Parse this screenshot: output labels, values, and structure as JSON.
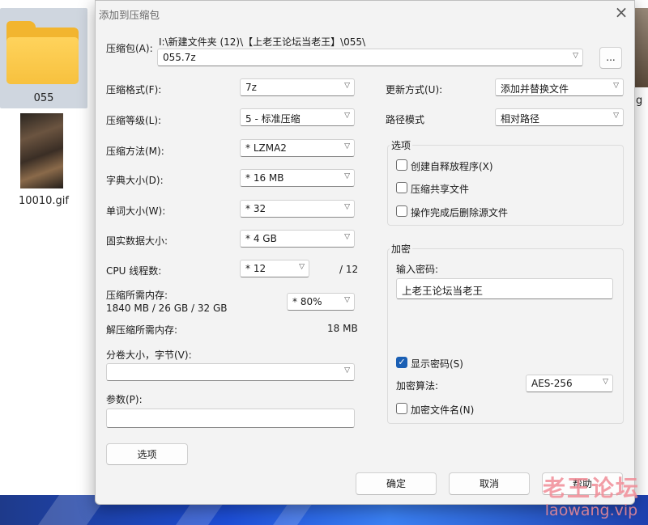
{
  "desktop": {
    "files": [
      {
        "name": "055"
      },
      {
        "name": "10010.gif"
      }
    ],
    "edge_label": "g"
  },
  "dialog": {
    "title": "添加到压缩包",
    "close_icon": "×",
    "archive": {
      "label": "压缩包(A):",
      "path": "I:\\新建文件夹 (12)\\【上老王论坛当老王】\\055\\",
      "name": "055.7z",
      "browse_label": "..."
    },
    "left": {
      "format": {
        "label": "压缩格式(F):",
        "value": "7z"
      },
      "level": {
        "label": "压缩等级(L):",
        "value": "5 - 标准压缩"
      },
      "method": {
        "label": "压缩方法(M):",
        "value": "* LZMA2"
      },
      "dict": {
        "label": "字典大小(D):",
        "value": "* 16 MB"
      },
      "word": {
        "label": "单词大小(W):",
        "value": "* 32"
      },
      "solid": {
        "label": "固实数据大小:",
        "value": "* 4 GB"
      },
      "cpu": {
        "label": "CPU 线程数:",
        "value": "* 12",
        "max": "/ 12"
      },
      "mem": {
        "label": "压缩所需内存:",
        "detail": "1840 MB / 26 GB / 32 GB",
        "value": "* 80%"
      },
      "decomp": {
        "label": "解压缩所需内存:",
        "value": "18 MB"
      },
      "split": {
        "label": "分卷大小，字节(V):",
        "value": ""
      },
      "params": {
        "label": "参数(P):",
        "value": ""
      },
      "options_button": "选项"
    },
    "right": {
      "update": {
        "label": "更新方式(U):",
        "value": "添加并替换文件"
      },
      "pathmode": {
        "label": "路径模式",
        "value": "相对路径"
      },
      "options_group": {
        "title": "选项",
        "sfx": {
          "label": "创建自释放程序(X)",
          "checked": false
        },
        "shared": {
          "label": "压缩共享文件",
          "checked": false
        },
        "delete": {
          "label": "操作完成后删除源文件",
          "checked": false
        }
      },
      "encrypt_group": {
        "title": "加密",
        "password_label": "输入密码:",
        "password": "上老王论坛当老王",
        "show_password": {
          "label": "显示密码(S)",
          "checked": true
        },
        "method_label": "加密算法:",
        "method": "AES-256",
        "encrypt_names": {
          "label": "加密文件名(N)",
          "checked": false
        }
      }
    },
    "buttons": {
      "ok": "确定",
      "cancel": "取消",
      "help": "帮助"
    }
  },
  "watermark": {
    "line1": "老王论坛",
    "line2": "laowang.vip"
  }
}
